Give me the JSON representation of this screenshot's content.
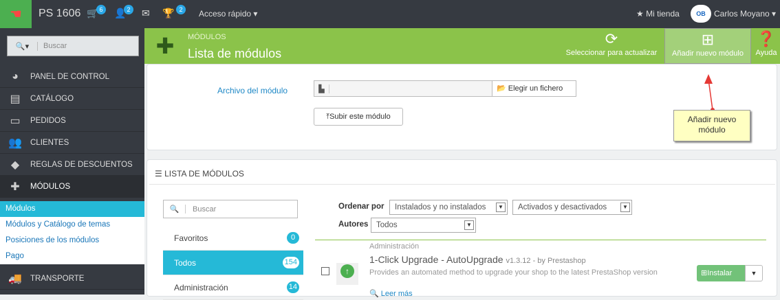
{
  "topbar": {
    "shop_name": "PS 1606",
    "cart_count": "6",
    "customers_count": "2",
    "trophy_count": "2",
    "quick_access": "Acceso rápido",
    "my_store": "Mi tienda",
    "user_name": "Carlos Moyano",
    "avatar_text": "OB"
  },
  "sidebar": {
    "search_placeholder": "Buscar",
    "items": [
      {
        "label": "PANEL DE CONTROL"
      },
      {
        "label": "CATÁLOGO"
      },
      {
        "label": "PEDIDOS"
      },
      {
        "label": "CLIENTES"
      },
      {
        "label": "REGLAS DE DESCUENTOS"
      },
      {
        "label": "MÓDULOS"
      },
      {
        "label": "TRANSPORTE"
      }
    ],
    "submenu": [
      {
        "label": "Módulos"
      },
      {
        "label": "Módulos y Catálogo de temas"
      },
      {
        "label": "Posiciones de los módulos"
      },
      {
        "label": "Pago"
      }
    ]
  },
  "header": {
    "breadcrumb": "MÓDULOS",
    "title": "Lista de módulos",
    "btn_refresh": "Seleccionar para actualizar",
    "btn_add": "Añadir nuevo módulo",
    "btn_help": "Ayuda"
  },
  "upload": {
    "label": "Archivo del módulo",
    "choose": "Elegir un fichero",
    "submit": "Subir este módulo"
  },
  "callout": {
    "line1": "Añadir nuevo",
    "line2": "módulo"
  },
  "list": {
    "title": "LISTA DE MÓDULOS",
    "search_placeholder": "Buscar",
    "categories": [
      {
        "label": "Favoritos",
        "count": "0"
      },
      {
        "label": "Todos",
        "count": "154"
      },
      {
        "label": "Administración",
        "count": "14"
      }
    ],
    "sort_label": "Ordenar por",
    "sort_value": "Instalados y no instalados",
    "filter_value": "Activados y desactivados",
    "authors_label": "Autores",
    "authors_value": "Todos"
  },
  "module": {
    "category": "Administración",
    "name": "1-Click Upgrade - AutoUpgrade",
    "version": "v1.3.12 - by Prestashop",
    "description": "Provides an automated method to upgrade your shop to the latest PrestaShop version",
    "more": "Leer más",
    "install": "Instalar"
  }
}
